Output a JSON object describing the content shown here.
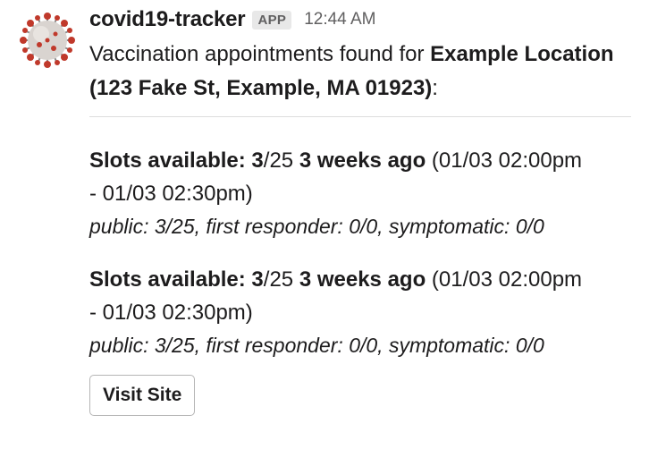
{
  "message": {
    "bot_name": "covid19-tracker",
    "badge": "APP",
    "timestamp": "12:44 AM",
    "intro_text": "Vaccination appointments found for ",
    "location": "Example Location (123 Fake St, Example, MA 01923)",
    "intro_suffix": ":"
  },
  "slots": [
    {
      "label": "Slots available:",
      "available": "3",
      "total": "/25",
      "relative_time": "3 weeks ago",
      "window_part1": " (01/03 02:00pm",
      "window_part2": "- 01/03 02:30pm)",
      "breakdown": "public: 3/25, first responder: 0/0, symptomatic: 0/0"
    },
    {
      "label": "Slots available:",
      "available": "3",
      "total": "/25",
      "relative_time": "3 weeks ago",
      "window_part1": " (01/03 02:00pm",
      "window_part2": "- 01/03 02:30pm)",
      "breakdown": "public: 3/25, first responder: 0/0, symptomatic: 0/0"
    }
  ],
  "actions": {
    "visit_site_label": "Visit Site"
  },
  "icons": {
    "avatar": "coronavirus-icon"
  },
  "colors": {
    "virus_body": "#d9d4d0",
    "virus_spike": "#c0392b"
  }
}
